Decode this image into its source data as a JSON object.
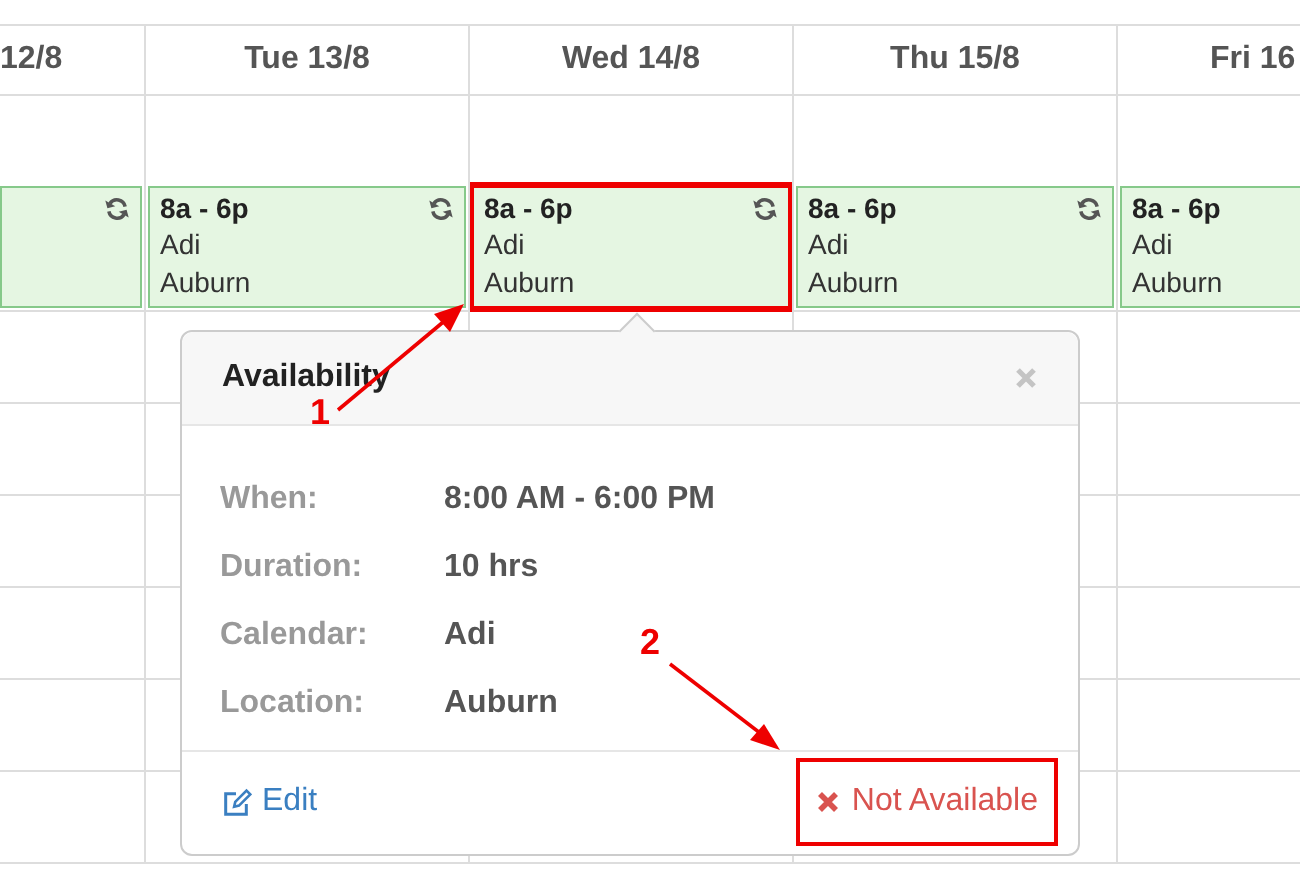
{
  "calendar": {
    "columns": [
      {
        "header": "12/8",
        "event": {
          "highlighted": false
        }
      },
      {
        "header": "Tue 13/8",
        "event": {
          "time": "8a - 6p",
          "calendar": "Adi",
          "location": "Auburn",
          "highlighted": false
        }
      },
      {
        "header": "Wed 14/8",
        "event": {
          "time": "8a - 6p",
          "calendar": "Adi",
          "location": "Auburn",
          "highlighted": true
        }
      },
      {
        "header": "Thu 15/8",
        "event": {
          "time": "8a - 6p",
          "calendar": "Adi",
          "location": "Auburn",
          "highlighted": false
        }
      },
      {
        "header": "Fri 16",
        "event": {
          "time": "8a - 6p",
          "calendar": "Adi",
          "location": "Auburn",
          "highlighted": false
        }
      }
    ]
  },
  "popover": {
    "title": "Availability",
    "details": [
      {
        "label": "When:",
        "value": "8:00 AM - 6:00 PM"
      },
      {
        "label": "Duration:",
        "value": "10 hrs"
      },
      {
        "label": "Calendar:",
        "value": "Adi"
      },
      {
        "label": "Location:",
        "value": "Auburn"
      }
    ],
    "edit_link": "Edit",
    "not_available_button": {
      "label": "Not Available",
      "highlighted": true
    }
  },
  "annotations": [
    "1",
    "2"
  ]
}
